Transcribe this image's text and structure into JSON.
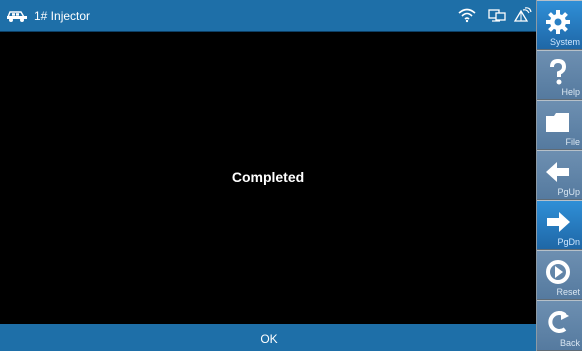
{
  "header": {
    "title": "1# Injector"
  },
  "status_icons": [
    "wifi-icon",
    "network-icon",
    "satellite-icon"
  ],
  "main": {
    "message": "Completed"
  },
  "footer": {
    "ok_label": "OK"
  },
  "sidebar": {
    "items": [
      {
        "label": "System",
        "icon": "gear-icon",
        "enabled": true
      },
      {
        "label": "Help",
        "icon": "question-icon",
        "enabled": false
      },
      {
        "label": "File",
        "icon": "folder-icon",
        "enabled": false
      },
      {
        "label": "PgUp",
        "icon": "arrow-left-icon",
        "enabled": false
      },
      {
        "label": "PgDn",
        "icon": "arrow-right-icon",
        "enabled": true
      },
      {
        "label": "Reset",
        "icon": "reset-icon",
        "enabled": false
      },
      {
        "label": "Back",
        "icon": "back-icon",
        "enabled": false
      }
    ]
  },
  "colors": {
    "bar": "#1e6fa8",
    "sidebar_active": "#2f8fd7",
    "sidebar_disabled": "#6d8fb1",
    "content_bg": "#000000",
    "text": "#ffffff"
  }
}
